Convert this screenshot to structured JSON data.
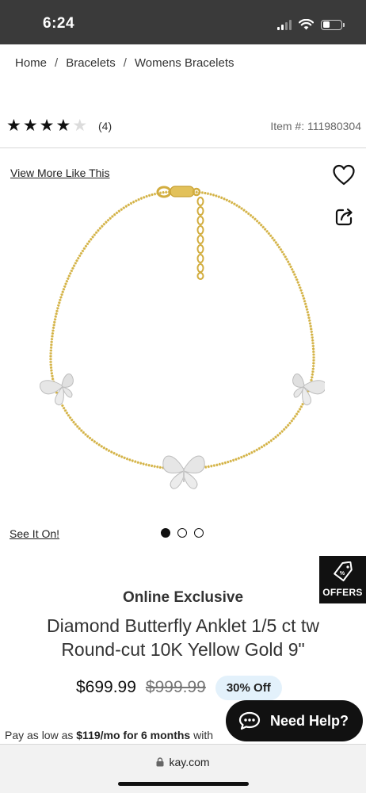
{
  "status_bar": {
    "time": "6:24"
  },
  "breadcrumb": {
    "items": [
      "Home",
      "Bracelets",
      "Womens Bracelets"
    ],
    "separator": "/"
  },
  "rating": {
    "stars_filled": 4,
    "stars_total": 5,
    "review_count": "(4)",
    "item_number": "Item #: 111980304"
  },
  "gallery": {
    "view_more_label": "View More Like This",
    "see_it_on_label": "See It On!",
    "slide_count": 3,
    "active_slide": 1,
    "product_image_icon": "butterfly-anklet-image"
  },
  "offers": {
    "label": "OFFERS",
    "icon": "tag-percent-icon"
  },
  "product": {
    "badge": "Online Exclusive",
    "title": "Diamond Butterfly Anklet 1/5 ct tw Round-cut 10K Yellow Gold 9\""
  },
  "pricing": {
    "sale_price": "$699.99",
    "original_price": "$999.99",
    "discount": "30% Off"
  },
  "financing": {
    "prefix": "Pay as low as ",
    "amount": "$119/mo for 6 months",
    "suffix": " with"
  },
  "chat": {
    "label": "Need Help?",
    "icon": "chat-bubble-icon"
  },
  "browser": {
    "url": "kay.com"
  },
  "colors": {
    "status_bar_bg": "#3a3a3a",
    "gold": "#d9b94c",
    "discount_badge_bg": "#e3f1fb",
    "dark": "#111111"
  }
}
